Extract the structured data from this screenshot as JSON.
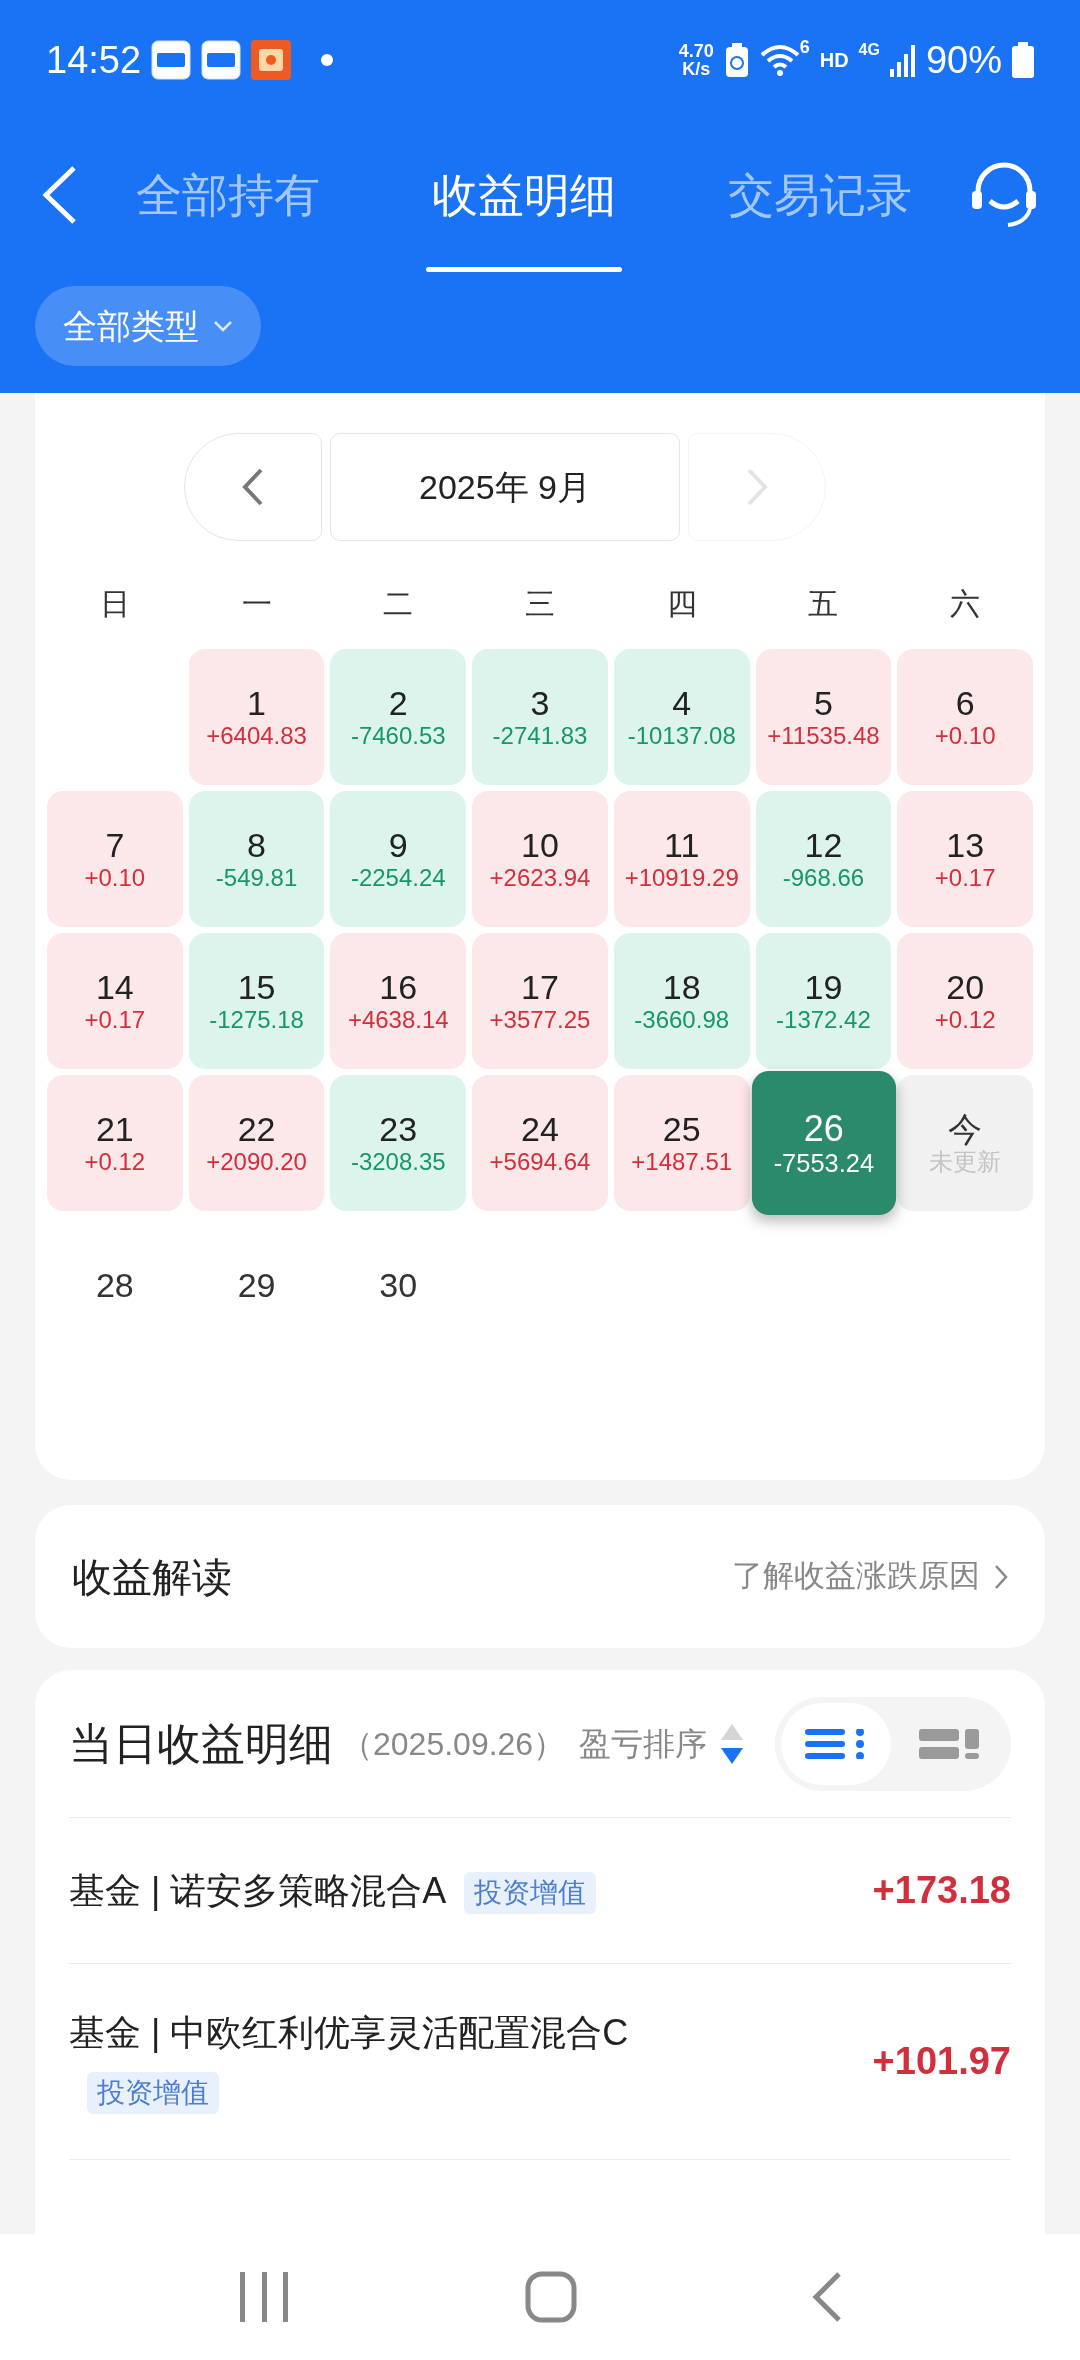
{
  "status_bar": {
    "time": "14:52",
    "net_speed": "4.70",
    "net_unit": "K/s",
    "wifi_label": "6",
    "hd": "HD",
    "network": "4G",
    "battery": "90%"
  },
  "header": {
    "tabs": [
      {
        "label": "全部持有",
        "selected": false
      },
      {
        "label": "收益明细",
        "selected": true
      },
      {
        "label": "交易记录",
        "selected": false
      }
    ],
    "filter": "全部类型"
  },
  "calendar": {
    "month": "2025年 9月",
    "weekdays": [
      "日",
      "一",
      "二",
      "三",
      "四",
      "五",
      "六"
    ],
    "days": [
      {
        "kind": "blank"
      },
      {
        "kind": "gain",
        "day": "1",
        "amount": "+6404.83",
        "selected": false
      },
      {
        "kind": "loss",
        "day": "2",
        "amount": "-7460.53",
        "selected": false
      },
      {
        "kind": "loss",
        "day": "3",
        "amount": "-2741.83",
        "selected": false
      },
      {
        "kind": "loss",
        "day": "4",
        "amount": "-10137.08",
        "selected": false
      },
      {
        "kind": "gain",
        "day": "5",
        "amount": "+11535.48",
        "selected": false
      },
      {
        "kind": "gain",
        "day": "6",
        "amount": "+0.10",
        "selected": false
      },
      {
        "kind": "gain",
        "day": "7",
        "amount": "+0.10",
        "selected": false
      },
      {
        "kind": "loss",
        "day": "8",
        "amount": "-549.81",
        "selected": false
      },
      {
        "kind": "loss",
        "day": "9",
        "amount": "-2254.24",
        "selected": false
      },
      {
        "kind": "gain",
        "day": "10",
        "amount": "+2623.94",
        "selected": false
      },
      {
        "kind": "gain",
        "day": "11",
        "amount": "+10919.29",
        "selected": false
      },
      {
        "kind": "loss",
        "day": "12",
        "amount": "-968.66",
        "selected": false
      },
      {
        "kind": "gain",
        "day": "13",
        "amount": "+0.17",
        "selected": false
      },
      {
        "kind": "gain",
        "day": "14",
        "amount": "+0.17",
        "selected": false
      },
      {
        "kind": "loss",
        "day": "15",
        "amount": "-1275.18",
        "selected": false
      },
      {
        "kind": "gain",
        "day": "16",
        "amount": "+4638.14",
        "selected": false
      },
      {
        "kind": "gain",
        "day": "17",
        "amount": "+3577.25",
        "selected": false
      },
      {
        "kind": "loss",
        "day": "18",
        "amount": "-3660.98",
        "selected": false
      },
      {
        "kind": "loss",
        "day": "19",
        "amount": "-1372.42",
        "selected": false
      },
      {
        "kind": "gain",
        "day": "20",
        "amount": "+0.12",
        "selected": false
      },
      {
        "kind": "gain",
        "day": "21",
        "amount": "+0.12",
        "selected": false
      },
      {
        "kind": "gain",
        "day": "22",
        "amount": "+2090.20",
        "selected": false
      },
      {
        "kind": "loss",
        "day": "23",
        "amount": "-3208.35",
        "selected": false
      },
      {
        "kind": "gain",
        "day": "24",
        "amount": "+5694.64",
        "selected": false
      },
      {
        "kind": "gain",
        "day": "25",
        "amount": "+1487.51",
        "selected": false
      },
      {
        "kind": "loss",
        "day": "26",
        "amount": "-7553.24",
        "selected": true
      },
      {
        "kind": "pending",
        "day": "今",
        "amount": "未更新",
        "selected": false
      },
      {
        "kind": "plain",
        "day": "28",
        "selected": false
      },
      {
        "kind": "plain",
        "day": "29",
        "selected": false
      },
      {
        "kind": "plain",
        "day": "30",
        "selected": false
      }
    ]
  },
  "insight": {
    "title": "收益解读",
    "link": "了解收益涨跌原因"
  },
  "details": {
    "title": "当日收益明细",
    "date": "（2025.09.26）",
    "sort": "盈亏排序",
    "views": [
      {
        "kind": "list",
        "selected": true
      },
      {
        "kind": "card",
        "selected": false
      }
    ],
    "rows": [
      {
        "name": "基金 | 诺安多策略混合A",
        "tag": "投资增值",
        "amount": "+173.18"
      },
      {
        "name": "基金 | 中欧红利优享灵活配置混合C",
        "tag": "投资增值",
        "amount": "+101.97"
      }
    ]
  }
}
